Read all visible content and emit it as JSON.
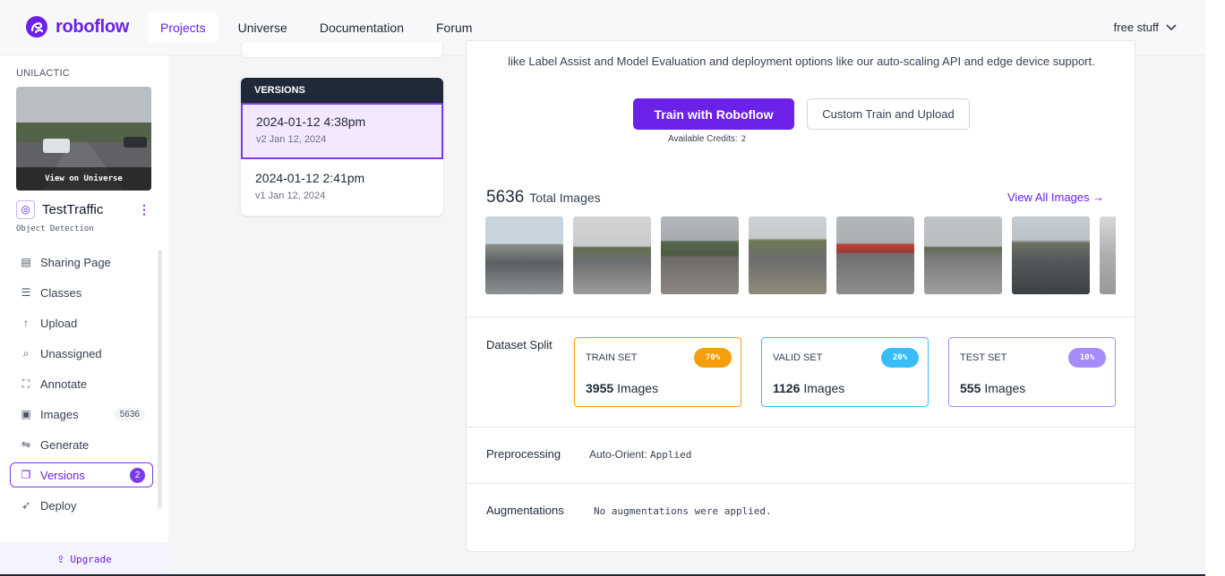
{
  "brand": {
    "name": "roboflow",
    "color": "#6b21e8"
  },
  "topnav": {
    "items": [
      {
        "label": "Projects",
        "active": true
      },
      {
        "label": "Universe",
        "active": false
      },
      {
        "label": "Documentation",
        "active": false
      },
      {
        "label": "Forum",
        "active": false
      }
    ],
    "user_menu": "free stuff"
  },
  "sidebar": {
    "workspace": "UNILACTIC",
    "view_on_universe": "View on Universe",
    "project_name": "TestTraffic",
    "project_type": "Object Detection",
    "items": [
      {
        "label": "Sharing Page",
        "icon": "document-icon"
      },
      {
        "label": "Classes",
        "icon": "list-icon"
      },
      {
        "label": "Upload",
        "icon": "arrow-up-icon"
      },
      {
        "label": "Unassigned",
        "icon": "search-icon"
      },
      {
        "label": "Annotate",
        "icon": "annotate-icon"
      },
      {
        "label": "Images",
        "icon": "images-icon",
        "count": "5636"
      },
      {
        "label": "Generate",
        "icon": "generate-icon"
      },
      {
        "label": "Versions",
        "icon": "versions-icon",
        "count": "2",
        "active": true
      },
      {
        "label": "Deploy",
        "icon": "rocket-icon"
      }
    ],
    "upgrade": "Upgrade"
  },
  "versions": {
    "header": "VERSIONS",
    "items": [
      {
        "title": "2024-01-12 4:38pm",
        "subtitle": "v2 Jan 12, 2024",
        "active": true
      },
      {
        "title": "2024-01-12 2:41pm",
        "subtitle": "v1 Jan 12, 2024",
        "active": false
      }
    ]
  },
  "main": {
    "train_note": "like Label Assist and Model Evaluation and deployment options like our auto-scaling API and edge device support.",
    "train_button": "Train with Roboflow",
    "custom_button": "Custom Train and Upload",
    "credits_label": "Available Credits:",
    "credits_value": "2",
    "total_count": "5636",
    "total_label": "Total Images",
    "view_all": "View All Images →",
    "dataset_split_label": "Dataset Split",
    "splits": [
      {
        "name": "TRAIN SET",
        "percent": "70%",
        "count": "3955",
        "unit": "Images",
        "color": "#f59e0b"
      },
      {
        "name": "VALID SET",
        "percent": "20%",
        "count": "1126",
        "unit": "Images",
        "color": "#38bdf8"
      },
      {
        "name": "TEST SET",
        "percent": "10%",
        "count": "555",
        "unit": "Images",
        "color": "#a78bfa"
      }
    ],
    "preprocessing_label": "Preprocessing",
    "preprocessing_key": "Auto-Orient:",
    "preprocessing_value": "Applied",
    "augmentations_label": "Augmentations",
    "augmentations_value": "No augmentations were applied."
  }
}
